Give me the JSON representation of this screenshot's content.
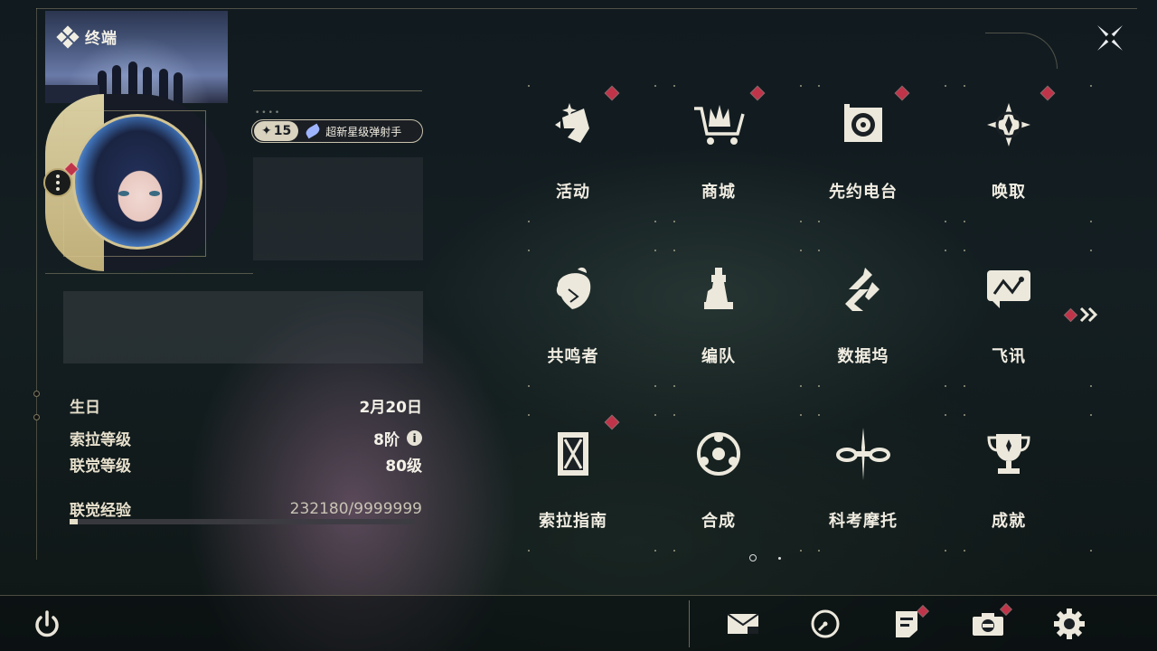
{
  "header": {
    "terminal_label": "终端",
    "close_icon": "close-x-icon"
  },
  "profile": {
    "level_value": "15",
    "level_prefix": "✦",
    "title": "超新星级弹射手",
    "birthday_label": "生日",
    "birthday_value": "2月20日",
    "sola_rank_label": "索拉等级",
    "sola_rank_value": "8阶",
    "union_level_label": "联觉等级",
    "union_level_value": "80级",
    "union_exp_label": "联觉经验",
    "union_exp_value": "232180/9999999",
    "union_exp_progress": 0.023
  },
  "menu": {
    "row1": [
      {
        "label": "活动",
        "icon": "activity-icon",
        "badge": true
      },
      {
        "label": "商城",
        "icon": "shop-cart-icon",
        "badge": true
      },
      {
        "label": "先约电台",
        "icon": "radio-icon",
        "badge": true
      },
      {
        "label": "唤取",
        "icon": "convene-icon",
        "badge": true
      }
    ],
    "row2": [
      {
        "label": "共鸣者",
        "icon": "resonator-icon",
        "badge": false
      },
      {
        "label": "编队",
        "icon": "team-chess-icon",
        "badge": false
      },
      {
        "label": "数据坞",
        "icon": "data-bank-icon",
        "badge": false
      },
      {
        "label": "飞讯",
        "icon": "message-icon",
        "badge": false
      }
    ],
    "row3": [
      {
        "label": "索拉指南",
        "icon": "guidebook-icon",
        "badge": true
      },
      {
        "label": "合成",
        "icon": "synthesis-icon",
        "badge": false
      },
      {
        "label": "科考摩托",
        "icon": "motorcycle-icon",
        "badge": false
      },
      {
        "label": "成就",
        "icon": "trophy-icon",
        "badge": false
      }
    ],
    "page_count": 2,
    "current_page": 1
  },
  "bottom_bar": {
    "items": [
      "power-icon",
      "mail-icon",
      "clock-icon",
      "notice-icon",
      "camera-icon",
      "settings-gear-icon"
    ]
  }
}
